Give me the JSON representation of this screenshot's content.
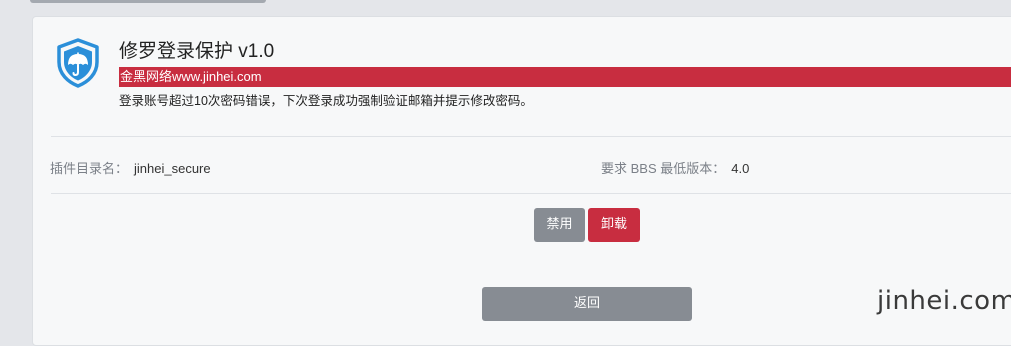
{
  "plugin": {
    "title": "修罗登录保护 v1.0",
    "highlight_text": "金黑网络www.jinhei.com",
    "description": "登录账号超过10次密码错误，下次登录成功强制验证邮箱并提示修改密码。",
    "dir_label": "插件目录名：",
    "dir_value": "jinhei_secure",
    "min_version_label": "要求 BBS 最低版本：",
    "min_version_value": "4.0",
    "icon": "shield-umbrella-icon"
  },
  "buttons": {
    "disable_label": "禁用",
    "uninstall_label": "卸载",
    "back_label": "返回"
  },
  "watermark": "jinhei.com",
  "colors": {
    "accent_red": "#c82d40",
    "button_gray": "#878c93",
    "icon_blue": "#2b8fd9"
  }
}
